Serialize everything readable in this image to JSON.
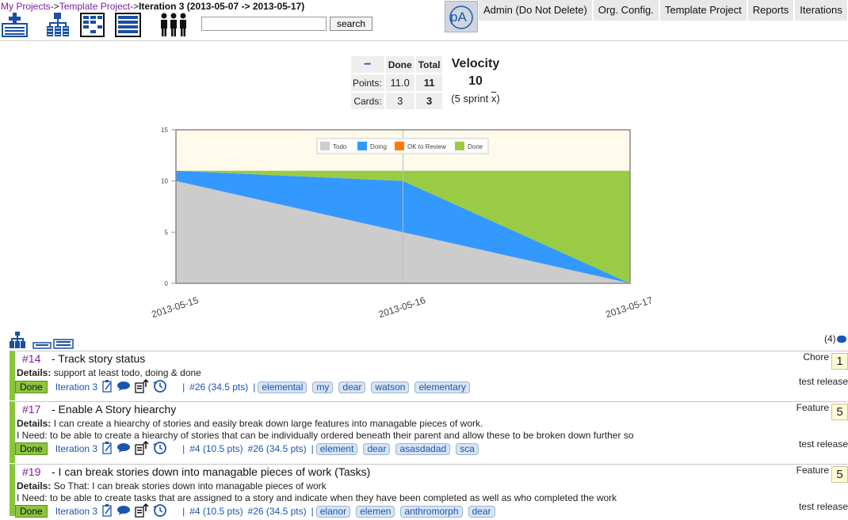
{
  "breadcrumb": {
    "items": [
      "My Projects",
      "Template Project"
    ],
    "separator": "->",
    "current": "Iteration 3 (2013-05-07 -> 2013-05-17)"
  },
  "search": {
    "value": "",
    "button_label": "search"
  },
  "toolbar_icons": [
    "add-story-icon",
    "hierarchy-icon",
    "board-icon",
    "list-icon",
    "people-icon"
  ],
  "logo": {
    "text": "pA"
  },
  "nav": {
    "tabs": [
      "Admin (Do Not Delete)",
      "Org. Config.",
      "Template Project",
      "Reports",
      "Iterations"
    ]
  },
  "stats": {
    "collapse_symbol": "−",
    "col_done": "Done",
    "col_total": "Total",
    "points_label": "Points:",
    "points_done": "11.0",
    "points_total": "11",
    "cards_label": "Cards:",
    "cards_done": "3",
    "cards_total": "3",
    "velocity_title": "Velocity",
    "velocity_value": "10",
    "velocity_note_prefix": "(5 sprint ",
    "velocity_note_symbol": "x",
    "velocity_note_suffix": ")"
  },
  "chart_data": {
    "type": "area",
    "x": [
      "2013-05-15",
      "2013-05-16",
      "2013-05-17"
    ],
    "series": [
      {
        "name": "Todo",
        "values": [
          10,
          5,
          0
        ],
        "color": "#cccccc"
      },
      {
        "name": "Doing",
        "values": [
          1,
          5,
          0
        ],
        "color": "#3399ff"
      },
      {
        "name": "OK to Review",
        "values": [
          0,
          0,
          0
        ],
        "color": "#ff7a00"
      },
      {
        "name": "Done",
        "values": [
          0,
          1,
          11
        ],
        "color": "#99cc44"
      }
    ],
    "stacked": true,
    "ylim": [
      0,
      15
    ],
    "yticks": [
      0,
      5,
      10,
      15
    ],
    "legend": "top-center",
    "grid": false
  },
  "list": {
    "comment_count": "(4)"
  },
  "stories": [
    {
      "id": "#14",
      "title": "- Track story status",
      "details_label": "Details:",
      "details": "support at least todo, doing & done",
      "need": "",
      "status": "Done",
      "iteration": "Iteration 3",
      "parents": [
        "#26 (34.5 pts)"
      ],
      "tags": [
        "elemental",
        "my",
        "dear",
        "watson",
        "elementary"
      ],
      "type": "Chore",
      "points": "1",
      "release": "test release"
    },
    {
      "id": "#17",
      "title": "- Enable A Story hiearchy",
      "details_label": "Details:",
      "details": "I can create a hiearchy of stories and easily break down large features into managable pieces of work.",
      "need": "I Need: to be able to create a hiearchy of stories that can be individually ordered beneath their parent and allow these to be broken down further so",
      "status": "Done",
      "iteration": "Iteration 3",
      "parents": [
        "#4 (10.5 pts)",
        "#26 (34.5 pts)"
      ],
      "tags": [
        "element",
        "dear",
        "asasdadad",
        "sca"
      ],
      "type": "Feature",
      "points": "5",
      "release": "test release"
    },
    {
      "id": "#19",
      "title": "- I can break stories down into managable pieces of work (Tasks)",
      "details_label": "Details:",
      "details": "So That: I can break stories down into managable pieces of work",
      "need": "I Need: to be able to create tasks that are assigned to a story and indicate when they have been completed as well as who completed the work",
      "status": "Done",
      "iteration": "Iteration 3",
      "parents": [
        "#4 (10.5 pts)",
        "#26 (34.5 pts)"
      ],
      "tags": [
        "elanor",
        "elemen",
        "anthromorph",
        "dear"
      ],
      "type": "Feature",
      "points": "5",
      "release": "test release"
    }
  ]
}
